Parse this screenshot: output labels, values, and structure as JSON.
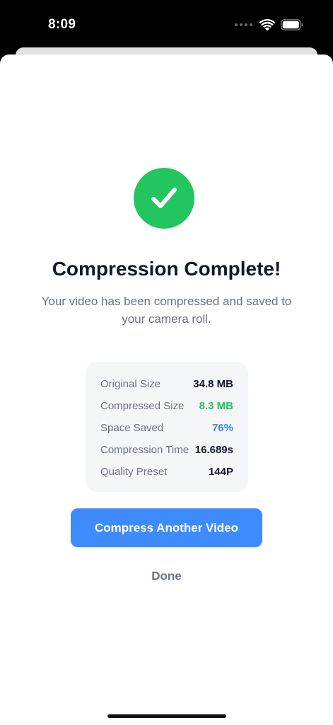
{
  "status_bar": {
    "time": "8:09"
  },
  "result": {
    "title": "Compression Complete!",
    "subtitle": "Your video has been compressed and saved to your camera roll."
  },
  "stats": [
    {
      "label": "Original Size",
      "value": "34.8 MB",
      "color": "#111827"
    },
    {
      "label": "Compressed Size",
      "value": "8.3 MB",
      "color": "#22c55e"
    },
    {
      "label": "Space Saved",
      "value": "76%",
      "color": "#3b82f6"
    },
    {
      "label": "Compression Time",
      "value": "16.689s",
      "color": "#111827"
    },
    {
      "label": "Quality Preset",
      "value": "144P",
      "color": "#111827"
    }
  ],
  "actions": {
    "primary_label": "Compress Another Video",
    "done_label": "Done"
  },
  "icons": {
    "success": "checkmark-circle-icon",
    "wifi": "wifi-icon",
    "battery": "battery-icon"
  },
  "colors": {
    "success": "#22c55e",
    "accent": "#3d8bfd",
    "highlight_blue": "#3b82f6"
  }
}
